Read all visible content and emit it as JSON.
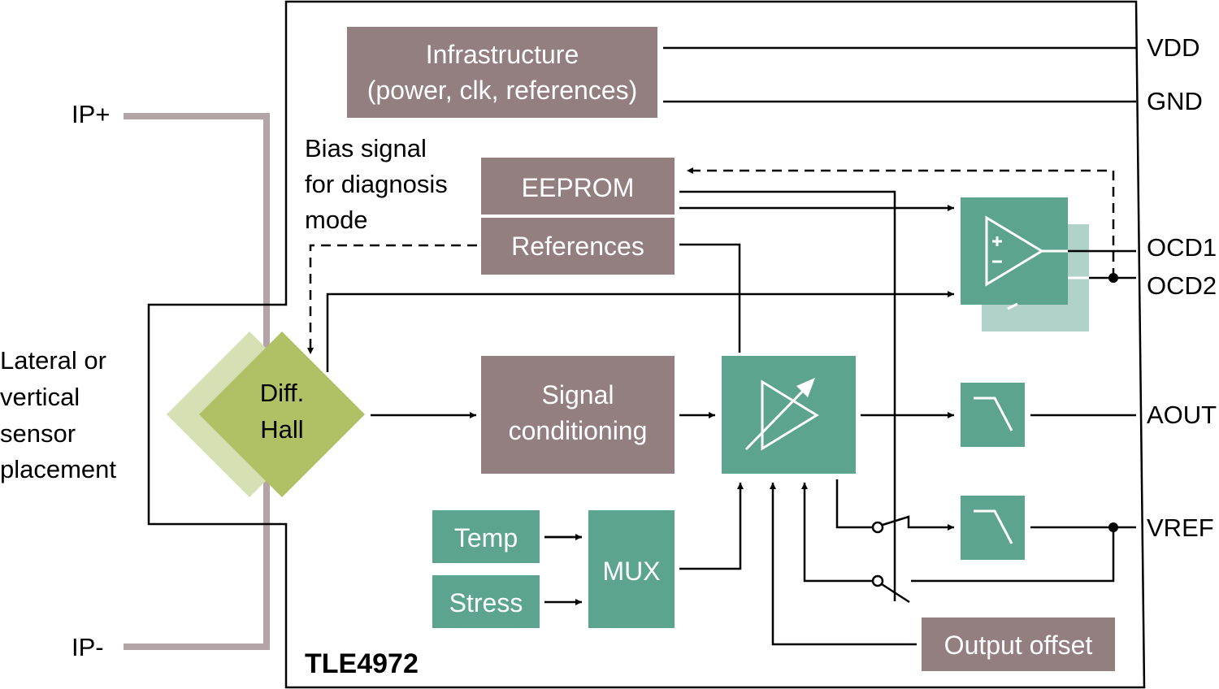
{
  "colors": {
    "brown": "#947f80",
    "teal": "#5ca48f",
    "light_teal": "#b0d2c8",
    "green": "#b0c064",
    "light_green": "#d6e0b5",
    "current_trace": "#b3a5a7"
  },
  "chip": {
    "name": "TLE4972"
  },
  "blocks": {
    "infrastructure": [
      "Infrastructure",
      "(power, clk, references)"
    ],
    "eeprom": "EEPROM",
    "references": "References",
    "hall": [
      "Diff.",
      "Hall"
    ],
    "signal_conditioning": [
      "Signal",
      "conditioning"
    ],
    "temp": "Temp",
    "stress": "Stress",
    "mux": "MUX",
    "output_offset": "Output offset"
  },
  "annotations": {
    "bias": [
      "Bias signal",
      "for diagnosis",
      "mode"
    ],
    "placement": [
      "Lateral or",
      "vertical",
      "sensor",
      "placement"
    ]
  },
  "pins": {
    "ip_plus": "IP+",
    "ip_minus": "IP-",
    "vdd": "VDD",
    "gnd": "GND",
    "ocd1": "OCD1",
    "ocd2": "OCD2",
    "aout": "AOUT",
    "vref": "VREF"
  },
  "icons": {
    "comparator": "comparator-icon",
    "amplifier": "variable-gain-amplifier-icon",
    "filter": "low-pass-filter-icon",
    "switch": "switch-icon"
  }
}
